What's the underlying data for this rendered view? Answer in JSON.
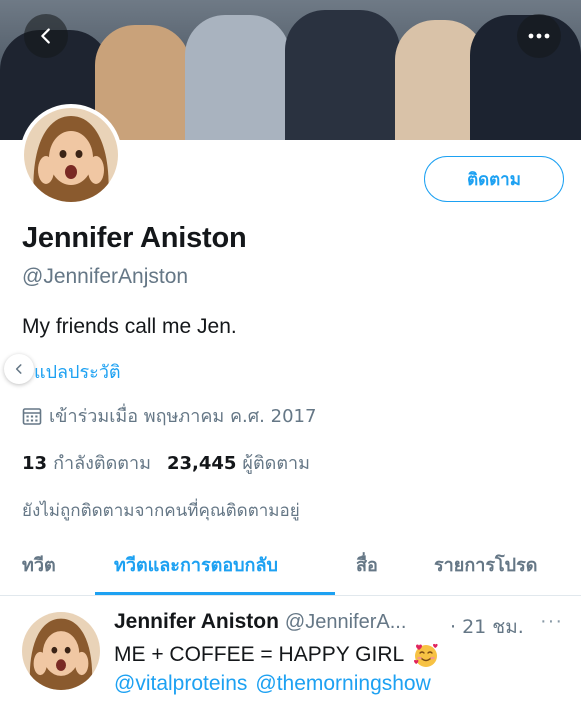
{
  "header": {
    "back_icon": "chevron-left-icon",
    "more_icon": "more-horizontal-icon"
  },
  "profile": {
    "follow_button": "ติดตาม",
    "name": "Jennifer Aniston",
    "handle": "@JenniferAnjston",
    "bio": "My friends call me Jen.",
    "translate_link": "แปลประวัติ",
    "joined": "เข้าร่วมเมื่อ พฤษภาคม ค.ศ. 2017",
    "following_count": "13",
    "following_label": "กำลังติดตาม",
    "followers_count": "23,445",
    "followers_label": "ผู้ติดตาม",
    "not_followed_note": "ยังไม่ถูกติดตามจากคนที่คุณติดตามอยู่"
  },
  "tabs": [
    {
      "label": "ทวีต",
      "active": false
    },
    {
      "label": "ทวีตและการตอบกลับ",
      "active": true
    },
    {
      "label": "สื่อ",
      "active": false
    },
    {
      "label": "รายการโปรด",
      "active": false
    }
  ],
  "tweet": {
    "name": "Jennifer Aniston",
    "handle": "@JenniferA...",
    "time": "· 21 ชม.",
    "more": "···",
    "text": "ME + COFFEE = HAPPY GIRL",
    "emoji": "smiling-face-with-hearts-icon",
    "mentions": [
      "@vitalproteins",
      "@themorningshow"
    ]
  },
  "colors": {
    "accent": "#1da1f2",
    "secondary_text": "#657786",
    "primary_text": "#14171a"
  }
}
